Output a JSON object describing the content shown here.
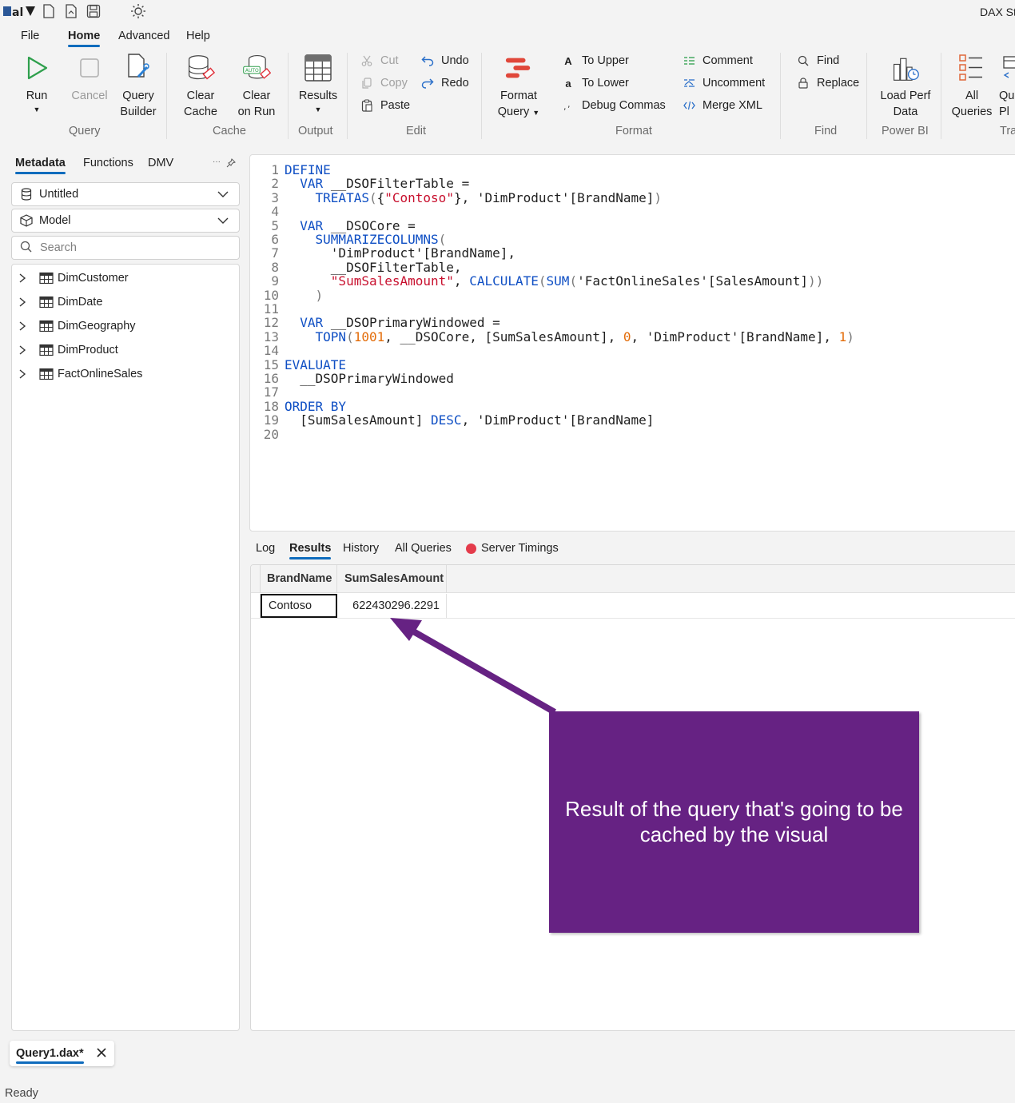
{
  "app": {
    "title": "DAX St"
  },
  "menu": {
    "tabs": [
      "File",
      "Home",
      "Advanced",
      "Help"
    ]
  },
  "ribbon": {
    "run": "Run",
    "cancel": "Cancel",
    "query_builder": [
      "Query",
      "Builder"
    ],
    "clear_cache": [
      "Clear",
      "Cache"
    ],
    "clear_on_run": [
      "Clear",
      "on Run"
    ],
    "results": "Results",
    "auto_badge": "AUTO",
    "cut": "Cut",
    "copy": "Copy",
    "paste": "Paste",
    "undo": "Undo",
    "redo": "Redo",
    "format_query": [
      "Format",
      "Query"
    ],
    "to_upper": "To Upper",
    "to_lower": "To Lower",
    "debug_commas": "Debug Commas",
    "comment": "Comment",
    "uncomment": "Uncomment",
    "merge_xml": "Merge XML",
    "find": "Find",
    "replace": "Replace",
    "load_perf_data": [
      "Load Perf",
      "Data"
    ],
    "all_queries": [
      "All",
      "Queries"
    ],
    "query_plan_partial": [
      "Qu",
      "Pl"
    ],
    "groups": [
      "Query",
      "Cache",
      "Output",
      "Edit",
      "Format",
      "Find",
      "Power BI",
      "Tra"
    ]
  },
  "left_panel": {
    "tabs": [
      "Metadata",
      "Functions",
      "DMV"
    ],
    "database": "Untitled",
    "model": "Model",
    "search_placeholder": "Search",
    "tables": [
      "DimCustomer",
      "DimDate",
      "DimGeography",
      "DimProduct",
      "FactOnlineSales"
    ]
  },
  "editor": {
    "lines": [
      "1",
      "2",
      "3",
      "4",
      "5",
      "6",
      "7",
      "8",
      "9",
      "10",
      "11",
      "12",
      "13",
      "14",
      "15",
      "16",
      "17",
      "18",
      "19",
      "20"
    ]
  },
  "bottom_tabs": [
    "Log",
    "Results",
    "History",
    "All Queries",
    "Server Timings"
  ],
  "results": {
    "columns": [
      "BrandName",
      "SumSalesAmount"
    ],
    "rows": [
      [
        "Contoso",
        "622430296.2291"
      ]
    ]
  },
  "annotation": {
    "text": "Result of the query that's going to be cached by the visual"
  },
  "document_tab": "Query1.dax*",
  "status": "Ready",
  "colors": {
    "accent": "#0f6cbd",
    "annotation_bg": "#662283",
    "keyword": "#0f4fc4",
    "string": "#c8102e",
    "number": "#e36c09"
  }
}
